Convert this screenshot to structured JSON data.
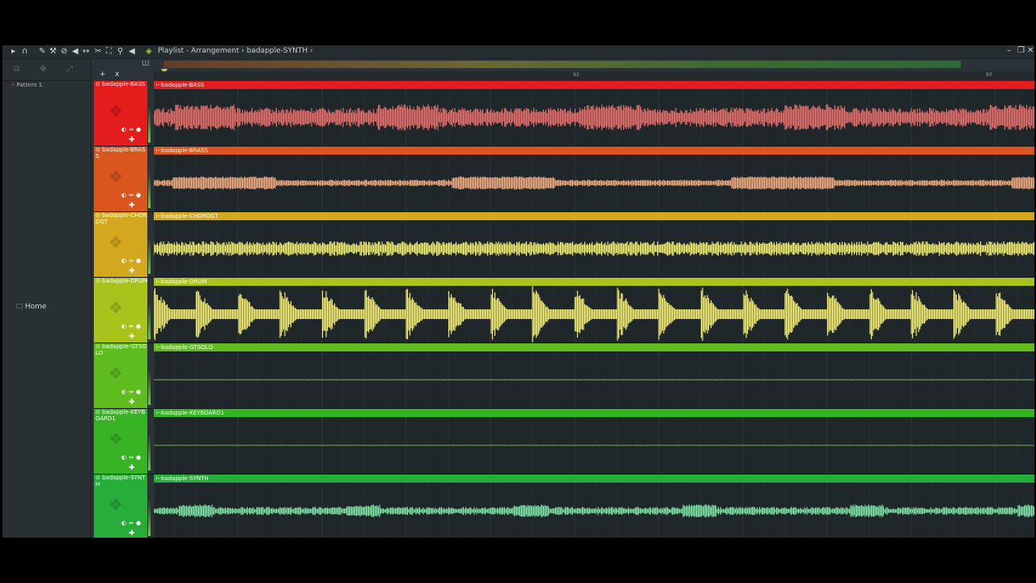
{
  "window": {
    "title": "Playlist - Arrangement",
    "breadcrumb_arrow": "›",
    "pattern_name": "badapple-SYNTH",
    "pattern_arrow": "›"
  },
  "toolbar": {
    "icons": [
      "play-icon",
      "magnet-icon",
      "pencil-icon",
      "paint-icon",
      "delete-icon",
      "mute-icon",
      "slip-icon",
      "slice-icon",
      "select-icon",
      "zoom-icon",
      "speaker-icon"
    ],
    "icon_glyphs": [
      "▸",
      "∩",
      "✎",
      "⚒",
      "⊘",
      "◀",
      "↔",
      "✂",
      "⛶",
      "⚲",
      "◀"
    ],
    "pattern_glyph": "◈"
  },
  "window_buttons": {
    "minimize": "–",
    "restore": "❐",
    "close": "✕"
  },
  "left_panel": {
    "pattern_item": "Pattern 1",
    "home_label": "Home",
    "header_glyphs": [
      "⧉",
      "✥",
      "⤢"
    ]
  },
  "track_controls": {
    "add": "+",
    "remove": "x",
    "bar_glyph": "Ш"
  },
  "ruler": {
    "marks": [
      "92",
      "93"
    ]
  },
  "colors": {
    "bass": "#e31c1c",
    "brass": "#d9561f",
    "chordgt": "#d4a81e",
    "drum": "#aac21c",
    "gtsolo": "#5fbd20",
    "keyboard1": "#38b324",
    "synth": "#26ad3a",
    "wave_bass": "#e8706c",
    "wave_brass": "#f1ad7f",
    "wave_chordgt": "#f2ee6e",
    "wave_drum": "#f4ef72",
    "wave_gtsolo": "#9fd36a",
    "wave_keyboard1": "#8cd05e",
    "wave_synth": "#7fe3a6"
  },
  "tracks": [
    {
      "name": "badapple-BASS",
      "clip": "badapple-BASS",
      "icon": "mute-icon"
    },
    {
      "name": "badapple-BRASS",
      "clip": "badapple-BRASS",
      "icon": "mute-icon"
    },
    {
      "name": "badapple-CHORDGT",
      "clip": "badapple-CHORDGT",
      "icon": "mute-icon"
    },
    {
      "name": "badapple-DRUM",
      "clip": "badapple-DRUM",
      "icon": "mute-icon"
    },
    {
      "name": "badapple-GTSOLO",
      "clip": "badapple-GTSOLO",
      "icon": "mute-icon"
    },
    {
      "name": "badapple-KEYBOARD1",
      "clip": "badapple-KEYBOARD1",
      "icon": "mute-icon"
    },
    {
      "name": "badapple-SYNTH",
      "clip": "badapple-SYNTH",
      "icon": "mute-icon"
    }
  ],
  "track_glyphs": {
    "header_dot": "⊙",
    "controls": "◐⇔●",
    "move": "✚",
    "clip_mark": "⊢",
    "deco": "❖"
  }
}
